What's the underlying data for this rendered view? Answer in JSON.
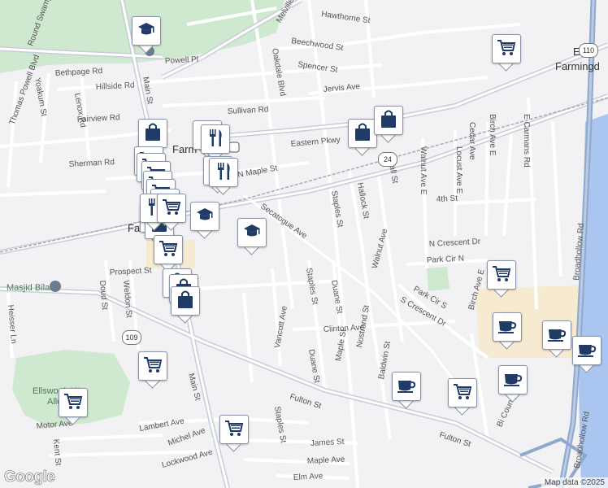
{
  "map": {
    "colors": {
      "background": "#f2f1f3",
      "road": "#ffffff",
      "arterial": "#c9cdd6",
      "park": "#cfe8d0",
      "highway": "#8fa8cc",
      "water": "#aac6f0",
      "commercial": "#f6ead1"
    },
    "streets": [
      "Round Swamp Rd",
      "Melville Rd",
      "Hawthorne St",
      "Beechwood St",
      "Spencer St",
      "Jervis Ave",
      "Oakdale Blvd",
      "Bethpage Rd",
      "Powell Pl",
      "Hillside Rd",
      "Main St",
      "Yoakum St",
      "Thomas Powell Blvd",
      "Lenox Rd",
      "Sullivan Rd",
      "Fairview Rd",
      "Eastern Pkwy",
      "Front St",
      "Sherman Rd",
      "N Maple St",
      "Main St",
      "Secatogue Ave",
      "Staples St",
      "Hallock St",
      "Wall St",
      "Walnut Ave E",
      "Locust Ave E",
      "Cedar Ave",
      "Birch Ave E",
      "E Carmans Rd",
      "4th St",
      "Broadhollow Rd",
      "N Crescent Dr",
      "Park Cir N",
      "Prospect St",
      "Doud St",
      "Weldon St",
      "Staples St",
      "Duane St",
      "Walnut Ave",
      "Park Cir S",
      "Birch Ave E",
      "S Crescent Dr",
      "Heisser Ln",
      "Vancott Ave",
      "Clinton Ave",
      "Maple St",
      "Nostrand St",
      "Duane St",
      "Baldwin St",
      "Fulton St",
      "Fulton St",
      "Main St",
      "Motor Ave",
      "Lambert Ave",
      "Michel Ave",
      "Kent St",
      "Lockwood Ave",
      "Staples St",
      "James St",
      "Maple Ave",
      "Elm Ave",
      "Bi County Blvd",
      "Broadhollow Rd"
    ],
    "places": {
      "town_east": "East",
      "town_east2": "Farmingd",
      "town_farm": "Farm",
      "town_farm_bottom": "Fa",
      "masjid": "Masjid Bilal",
      "ellsworth": "Ellsworth W.",
      "allen": "Allen"
    },
    "route_shields": [
      "110",
      "24",
      "109"
    ],
    "markers": [
      {
        "icon": "school-icon",
        "kind": "school"
      },
      {
        "icon": "cart-icon",
        "kind": "shopping"
      },
      {
        "icon": "bag-icon",
        "kind": "store"
      },
      {
        "icon": "restaurant-icon",
        "kind": "restaurant"
      },
      {
        "icon": "restaurant-icon",
        "kind": "restaurant"
      },
      {
        "icon": "restaurant-icon",
        "kind": "restaurant"
      },
      {
        "icon": "restaurant-icon",
        "kind": "restaurant"
      },
      {
        "icon": "bag-icon",
        "kind": "store"
      },
      {
        "icon": "bag-icon",
        "kind": "store"
      },
      {
        "icon": "school-icon",
        "kind": "school"
      },
      {
        "icon": "school-icon",
        "kind": "school"
      },
      {
        "icon": "cart-icon",
        "kind": "shopping"
      },
      {
        "icon": "bag-icon",
        "kind": "store"
      },
      {
        "icon": "bag-icon",
        "kind": "store"
      },
      {
        "icon": "cart-icon",
        "kind": "shopping"
      },
      {
        "icon": "cafe-icon",
        "kind": "cafe"
      },
      {
        "icon": "cafe-icon",
        "kind": "cafe"
      },
      {
        "icon": "cart-icon",
        "kind": "shopping"
      },
      {
        "icon": "cafe-icon",
        "kind": "cafe"
      },
      {
        "icon": "cafe-icon",
        "kind": "cafe"
      },
      {
        "icon": "cafe-icon",
        "kind": "cafe"
      },
      {
        "icon": "cart-icon",
        "kind": "shopping"
      },
      {
        "icon": "cart-icon",
        "kind": "shopping"
      },
      {
        "icon": "cart-icon",
        "kind": "shopping"
      },
      {
        "icon": "cart-icon",
        "kind": "shopping"
      }
    ],
    "attribution": "Map data ©2025",
    "logo": "Google"
  }
}
